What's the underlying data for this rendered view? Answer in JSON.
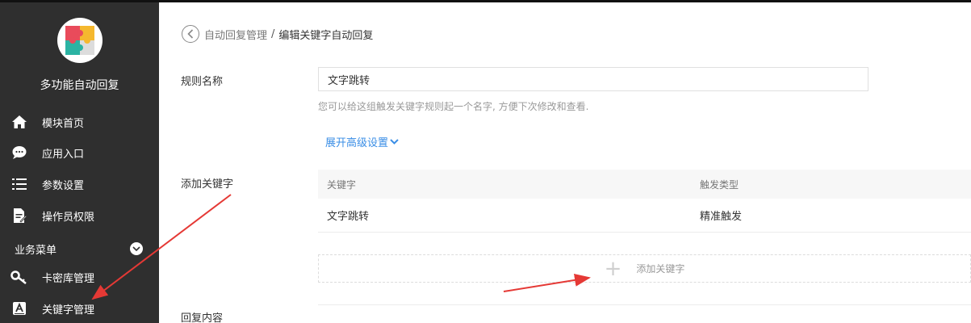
{
  "sidebar": {
    "app_name": "多功能自动回复",
    "items": [
      {
        "label": "模块首页",
        "icon": "home-icon"
      },
      {
        "label": "应用入口",
        "icon": "chat-bubble-icon"
      },
      {
        "label": "参数设置",
        "icon": "list-settings-icon"
      },
      {
        "label": "操作员权限",
        "icon": "document-edit-icon"
      }
    ],
    "section": {
      "label": "业务菜单",
      "items": [
        {
          "label": "卡密库管理",
          "icon": "key-icon"
        },
        {
          "label": "关键字管理",
          "icon": "keyword-icon"
        }
      ]
    }
  },
  "breadcrumb": {
    "parent": "自动回复管理",
    "separator": "/",
    "current": "编辑关键字自动回复"
  },
  "form": {
    "rule_name_label": "规则名称",
    "rule_name_value": "文字跳转",
    "rule_name_hint": "您可以给这组触发关键字规则起一个名字, 方便下次修改和查看.",
    "expand_advanced": "展开高级设置",
    "add_keyword_label": "添加关键字",
    "reply_content_label": "回复内容"
  },
  "keyword_table": {
    "headers": [
      "关键字",
      "触发类型"
    ],
    "rows": [
      {
        "keyword": "文字跳转",
        "type": "精准触发"
      }
    ],
    "add_button": "添加关键字"
  },
  "colors": {
    "sidebar_bg": "#2f2f2f",
    "link": "#3a8ee6",
    "annotation_arrow": "#e53935"
  }
}
